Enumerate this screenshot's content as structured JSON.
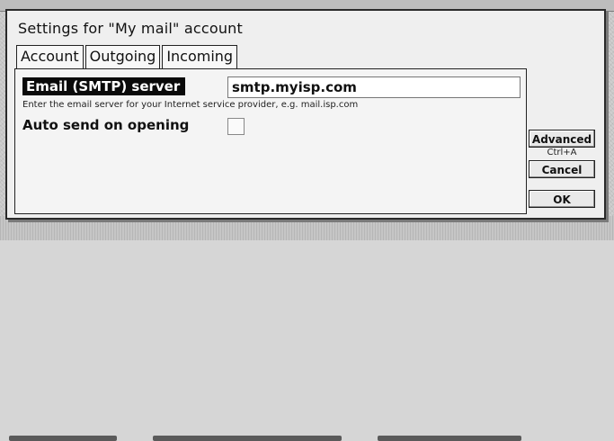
{
  "dialog": {
    "title": "Settings for \"My mail\" account"
  },
  "tabs": [
    {
      "label": "Account"
    },
    {
      "label": "Outgoing",
      "active": true
    },
    {
      "label": "Incoming"
    }
  ],
  "smtp": {
    "label": "Email (SMTP) server",
    "value": "smtp.myisp.com",
    "hint": "Enter the email server for your Internet service provider, e.g. mail.isp.com"
  },
  "auto_send": {
    "label": "Auto send on opening",
    "checked": false
  },
  "buttons": {
    "advanced": "Advanced",
    "advanced_shortcut": "Ctrl+A",
    "cancel": "Cancel",
    "ok": "OK"
  }
}
